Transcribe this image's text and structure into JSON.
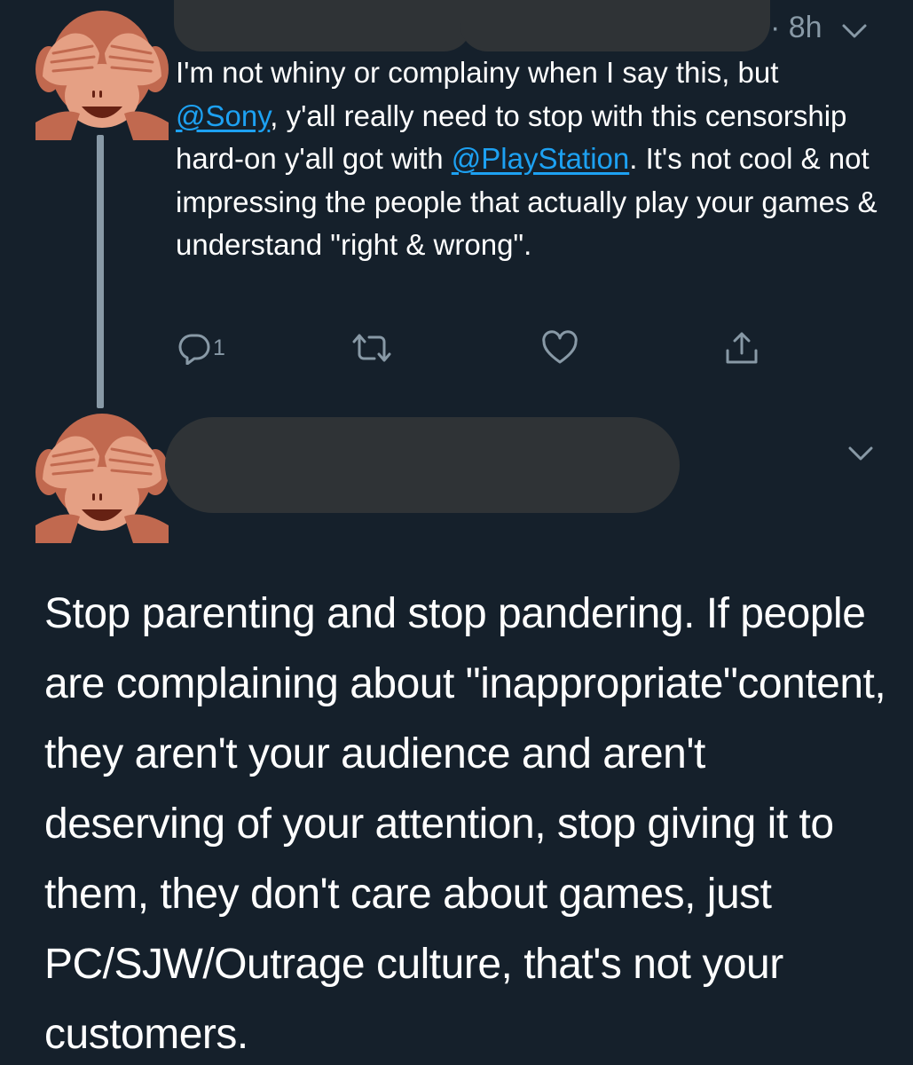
{
  "tweets": [
    {
      "timestamp": "· 8h",
      "text_parts": {
        "p1": "I'm not whiny or complainy when I say this, but ",
        "m1": "@Sony",
        "p2": ", y'all really need to stop with this censorship hard-on y'all got with ",
        "m2": "@PlayStation",
        "p3": ". It's not cool & not impressing the people that actually play your games & understand \"right & wrong\"."
      },
      "actions": {
        "reply_icon": "reply-icon",
        "reply_count": "1",
        "retweet_icon": "retweet-icon",
        "like_icon": "heart-icon",
        "share_icon": "share-icon"
      }
    },
    {
      "text": "Stop parenting and stop pandering. If people are complaining about \"inappropriate\"content, they aren't your audience and aren't deserving of your attention, stop giving it to them, they don't care about games, just PC/SJW/Outrage culture, that's not your customers."
    }
  ],
  "avatar_icon": "see-no-evil-monkey-icon",
  "colors": {
    "background": "#15202b",
    "link": "#1da1f2",
    "muted": "#8899a6",
    "redaction": "#2f3336"
  }
}
